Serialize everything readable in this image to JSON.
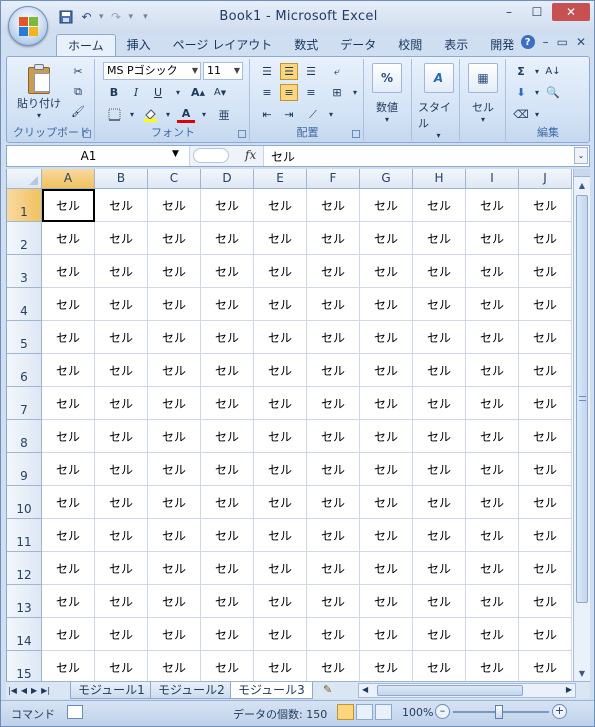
{
  "window": {
    "title": "Book1 - Microsoft Excel"
  },
  "tabs": [
    {
      "label": "ホーム",
      "active": true
    },
    {
      "label": "挿入"
    },
    {
      "label": "ページ レイアウト"
    },
    {
      "label": "数式"
    },
    {
      "label": "データ"
    },
    {
      "label": "校閲"
    },
    {
      "label": "表示"
    },
    {
      "label": "開発"
    }
  ],
  "ribbon": {
    "clipboard": {
      "paste_label": "貼り付け",
      "group_label": "クリップボード"
    },
    "font": {
      "font_name": "MS Pゴシック",
      "font_size": "11",
      "group_label": "フォント",
      "bold": "B",
      "italic": "I",
      "underline": "U"
    },
    "alignment": {
      "group_label": "配置"
    },
    "number": {
      "label": "数値",
      "icon_text": "%"
    },
    "style": {
      "label": "スタイル"
    },
    "cells": {
      "label": "セル"
    },
    "edit": {
      "group_label": "編集"
    }
  },
  "formula_bar": {
    "name_box": "A1",
    "fx": "fx",
    "formula": "セル"
  },
  "grid": {
    "columns": [
      "A",
      "B",
      "C",
      "D",
      "E",
      "F",
      "G",
      "H",
      "I",
      "J"
    ],
    "rows": [
      "1",
      "2",
      "3",
      "4",
      "5",
      "6",
      "7",
      "8",
      "9",
      "10",
      "11",
      "12",
      "13",
      "14",
      "15"
    ],
    "cell_value": "セル",
    "active_cell": "A1"
  },
  "sheets": [
    {
      "label": "モジュール1"
    },
    {
      "label": "モジュール2"
    },
    {
      "label": "モジュール3",
      "active": true
    }
  ],
  "status": {
    "mode": "コマンド",
    "count": "データの個数: 150",
    "zoom": "100%"
  },
  "colors": {
    "ribbon_bg": "#d2e2f5",
    "selected_header": "#f1c15f",
    "close_button": "#c75050"
  }
}
